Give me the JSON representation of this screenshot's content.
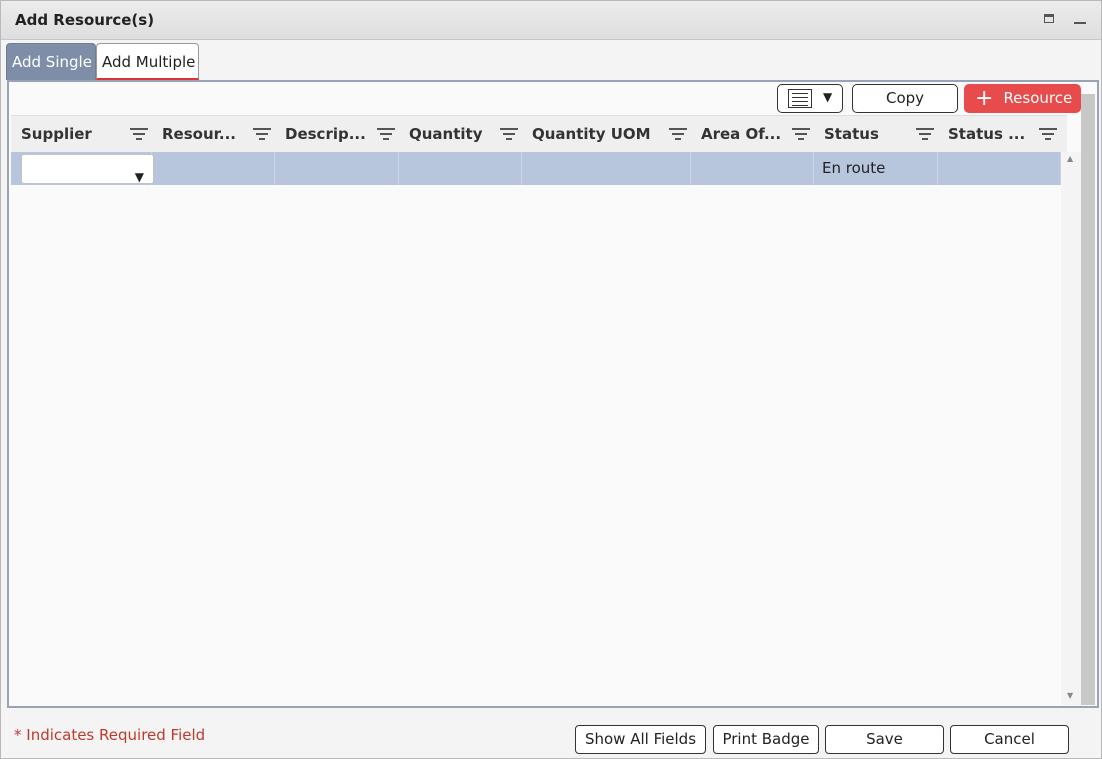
{
  "window": {
    "title": "Add Resource(s)"
  },
  "tabs": [
    {
      "label": "Add Single",
      "active": true
    },
    {
      "label": "Add Multiple",
      "active": false
    }
  ],
  "toolbar": {
    "copy_label": "Copy",
    "add_resource_label": "Resource",
    "add_resource_color": "#e84b4b"
  },
  "grid": {
    "columns": [
      "Supplier",
      "Resour...",
      "Descrip...",
      "Quantity",
      "Quantity UOM",
      "Area Of...",
      "Status",
      "Status ..."
    ],
    "rows": [
      {
        "supplier": "",
        "resource": "",
        "description": "",
        "quantity": "",
        "quantity_uom": "",
        "area_of": "",
        "status": "En route",
        "status_2": ""
      }
    ],
    "selected_row_color": "#b7c6dc"
  },
  "footer": {
    "required_note": "* Indicates Required Field",
    "buttons": {
      "show_all_fields": "Show All Fields",
      "print_badge": "Print Badge",
      "save": "Save",
      "cancel": "Cancel"
    }
  }
}
